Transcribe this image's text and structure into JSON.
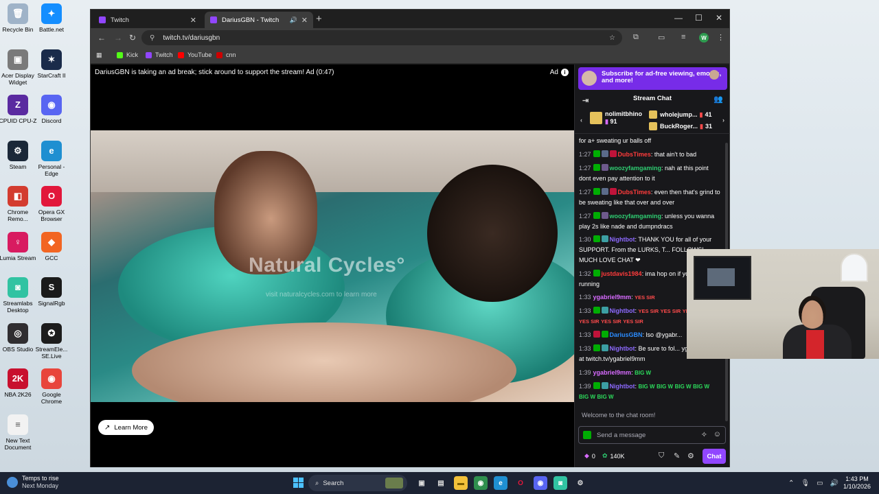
{
  "desktop": {
    "icons": [
      {
        "label": "Recycle Bin",
        "glyph": "🗑",
        "color": "#9fb3c8"
      },
      {
        "label": "Battle.net",
        "glyph": "✦",
        "color": "#148eff"
      },
      {
        "label": "Acer Display Widget",
        "glyph": "▣",
        "color": "#7a7a7a"
      },
      {
        "label": "StarCraft II",
        "glyph": "✶",
        "color": "#1a2b4a"
      },
      {
        "label": "CPUID CPU-Z",
        "glyph": "Z",
        "color": "#5a2aa0"
      },
      {
        "label": "Discord",
        "glyph": "◉",
        "color": "#5865f2"
      },
      {
        "label": "Steam",
        "glyph": "⚙",
        "color": "#1b2838"
      },
      {
        "label": "Personal - Edge",
        "glyph": "e",
        "color": "#1f8fd1"
      },
      {
        "label": "Chrome Remo...",
        "glyph": "◧",
        "color": "#d33c2f"
      },
      {
        "label": "Opera GX Browser",
        "glyph": "O",
        "color": "#e2173b"
      },
      {
        "label": "Lumia Stream",
        "glyph": "♀",
        "color": "#d81b60"
      },
      {
        "label": "GCC",
        "glyph": "◆",
        "color": "#f26522"
      },
      {
        "label": "Streamlabs Desktop",
        "glyph": "◙",
        "color": "#31c3a2"
      },
      {
        "label": "SignalRgb",
        "glyph": "S",
        "color": "#1a1a1a"
      },
      {
        "label": "OBS Studio",
        "glyph": "◎",
        "color": "#302e31"
      },
      {
        "label": "StreamEle... SE.Live",
        "glyph": "✪",
        "color": "#1c1c1c"
      },
      {
        "label": "NBA 2K26",
        "glyph": "2K",
        "color": "#c8102e"
      },
      {
        "label": "Google Chrome",
        "glyph": "◉",
        "color": "#e8453c"
      },
      {
        "label": "New Text Document",
        "glyph": "≡",
        "color": "#f2f2f2"
      }
    ]
  },
  "browser": {
    "tabs": [
      {
        "title": "Twitch",
        "active": false
      },
      {
        "title": "DariusGBN - Twitch",
        "active": true
      }
    ],
    "url": "twitch.tv/dariusgbn",
    "profile_initial": "W",
    "bookmarks": [
      {
        "label": "Kick",
        "color": "#53fc18"
      },
      {
        "label": "Twitch",
        "color": "#9146ff"
      },
      {
        "label": "YouTube",
        "color": "#ff0000"
      },
      {
        "label": "cnn",
        "color": "#cc0000"
      }
    ]
  },
  "player": {
    "ad_message": "DariusGBN is taking an ad break; stick around to support the stream! Ad (0:47)",
    "ad_badge": "Ad",
    "watermark": "Natural Cycles°",
    "watermark_sub": "visit naturalcycles.com to learn more",
    "learn_more": "Learn More"
  },
  "chat": {
    "sub_banner": "Subscribe for ad-free viewing, emotes, and more!",
    "title": "Stream Chat",
    "gifters": [
      {
        "name": "nolimitbhino",
        "count": "91"
      },
      {
        "name": "wholejump...",
        "count": "41"
      },
      {
        "name": "BuckRoger...",
        "count": "31"
      }
    ],
    "messages": [
      {
        "time": "",
        "user": "",
        "user_color": "#ffffff",
        "text": "for a+ sweating ur balls off"
      },
      {
        "time": "1:27",
        "user": "DubsTimes",
        "user_color": "#ff3b3b",
        "text": ": that ain't to bad"
      },
      {
        "time": "1:27",
        "user": "woozyfamgaming",
        "user_color": "#2ecc71",
        "text": ": nah at this point dont even pay attention to it"
      },
      {
        "time": "1:27",
        "user": "DubsTimes",
        "user_color": "#ff3b3b",
        "text": ": even then that's grind to be sweating like that over and over"
      },
      {
        "time": "1:27",
        "user": "woozyfamgaming",
        "user_color": "#2ecc71",
        "text": ": unless you wanna play 2s like nade and dumpndracs"
      },
      {
        "time": "1:30",
        "user": "Nightbot",
        "user_color": "#8d6aff",
        "text": ": THANK YOU for all of your SUPPORT. From the LURKS, T... FOLLOWS! MUCH LOVE CHAT ❤"
      },
      {
        "time": "1:32",
        "user": "justdavis1984",
        "user_color": "#ff3b3b",
        "text": ": ima hop on if you still running"
      },
      {
        "time": "1:33",
        "user": "ygabriel9mm",
        "user_color": "#d76bff",
        "text": ":"
      },
      {
        "time": "1:33",
        "user": "Nightbot",
        "user_color": "#8d6aff",
        "text": ":"
      },
      {
        "time": "1:33",
        "user": "DariusGBN",
        "user_color": "#2b8cff",
        "text": ": lso @ygabr..."
      },
      {
        "time": "1:33",
        "user": "Nightbot",
        "user_color": "#8d6aff",
        "text": ": Be sure to fol... ygabriel9mm at twitch.tv/ygabriel9mm"
      },
      {
        "time": "1:39",
        "user": "ygabriel9mm",
        "user_color": "#d76bff",
        "text": ":"
      },
      {
        "time": "1:39",
        "user": "Nightbot",
        "user_color": "#8d6aff",
        "text": ":"
      }
    ],
    "emote_yes_sir": "YES SIR",
    "emote_big_w": "BIG W",
    "welcome": "Welcome to the chat room!",
    "input_placeholder": "Send a message",
    "points": "0",
    "viewers": "140K",
    "chat_button": "Chat"
  },
  "taskbar": {
    "weather_title": "Temps to rise",
    "weather_sub": "Next Monday",
    "search_placeholder": "Search",
    "time": "1:43 PM",
    "date": "1/10/2026"
  }
}
